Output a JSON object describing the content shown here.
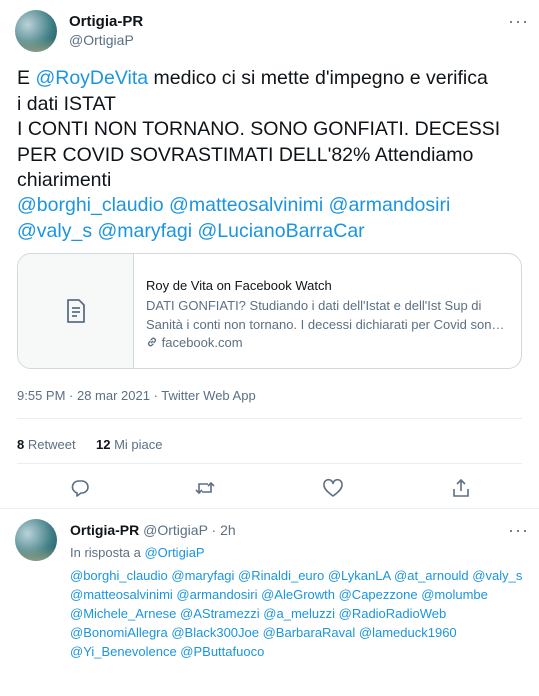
{
  "tweet": {
    "author_name": "Ortigia-PR",
    "author_handle": "@OrtigiaP",
    "more_icon": "more-dots-icon",
    "text_lines": [
      [
        "E ",
        "@RoyDeVita",
        "  medico ci si mette d'impegno e verifica"
      ],
      [
        "i dati ISTAT"
      ],
      [
        "I CONTI NON TORNANO.  SONO GONFIATI. DECESSI"
      ],
      [
        "PER  COVID  SOVRASTIMATI DELL'82% Attendiamo"
      ],
      [
        "chiarimenti"
      ]
    ],
    "intro": "E ",
    "mention_main": "@RoyDeVita",
    "text_rest": "  medico ci si mette d'impegno e verifica\ni dati ISTAT\nI CONTI NON TORNANO.  SONO GONFIATI. DECESSI\nPER  COVID  SOVRASTIMATI DELL'82% Attendiamo\nchiarimenti",
    "mentions_line1": "@borghi_claudio @matteosalvinimi @armandosiri",
    "mentions_line2": "@valy_s @maryfagi @LucianoBarraCar",
    "card": {
      "title": "Roy de Vita on Facebook Watch",
      "description": "DATI GONFIATI? Studiando i dati dell'Istat e dell'Ist Sup di Sanità i conti non tornano. I decessi dichiarati per Covid son…",
      "link": "facebook.com",
      "thumb_icon": "document-icon",
      "link_icon": "link-icon"
    },
    "timestamp": "9:55 PM · 28 mar 2021 · Twitter Web App",
    "retweets_count": "8",
    "retweets_label": "Retweet",
    "likes_count": "12",
    "likes_label": "Mi piace",
    "actions": [
      "reply-icon",
      "retweet-icon",
      "like-icon",
      "share-icon"
    ]
  },
  "reply": {
    "author_name": "Ortigia-PR",
    "author_handle_time": "@OrtigiaP · 2h",
    "in_reply_label": "In risposta a ",
    "in_reply_handle": "@OrtigiaP",
    "mentions": "@borghi_claudio @maryfagi @Rinaldi_euro @LykanLA @at_arnould @valy_s @matteosalvinimi @armandosiri @AleGrowth @Capezzone @molumbe @Michele_Arnese @AStramezzi @a_meluzzi @RadioRadioWeb @BonomiAllegra @Black300Joe @BarbaraRaval @lameduck1960 @Yi_Benevolence @PButtafuoco"
  },
  "colors": {
    "accent": "#1b95e0",
    "text": "#0f1419",
    "muted": "#5b7083",
    "border": "#cfd9de"
  }
}
